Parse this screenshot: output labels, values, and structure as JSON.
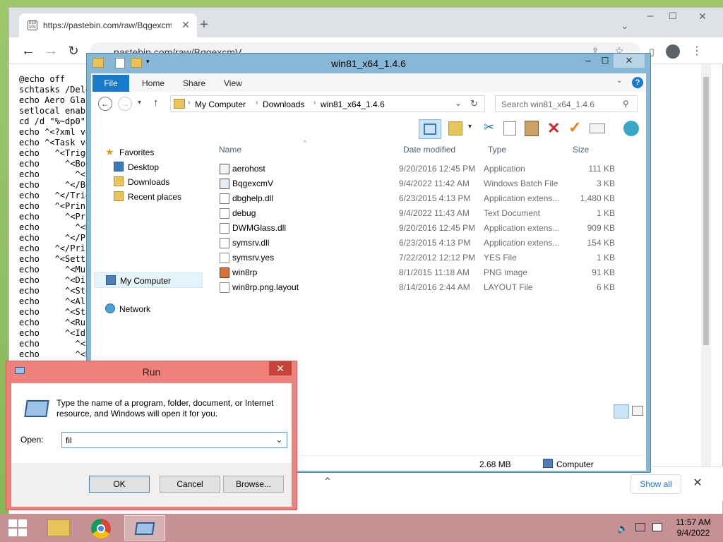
{
  "browser": {
    "tab_title": "https://pastebin.com/raw/BqgexcmV",
    "new_tab_glyph": "+",
    "url": "pastebin.com/raw/BqgexcmV",
    "code_lines": [
      "@echo off",
      "schtasks /Dele",
      "echo Aero Glas",
      "setlocal enabl",
      "cd /d \"%~dp0\"",
      "echo ^<?xml ve",
      "echo ^<Task ve",
      "echo   ^<Trigg",
      "echo     ^<Boo",
      "echo       ^<E",
      "echo     ^</Bo",
      "echo   ^</Trig",
      "echo   ^<Princ",
      "echo     ^<Pri",
      "echo       ^<R",
      "echo     ^</Pr",
      "echo   ^</Prin",
      "echo   ^<Setti",
      "echo     ^<Mul",
      "echo     ^<Dis",
      "echo     ^<Sto",
      "echo     ^<All",
      "echo     ^<Sta",
      "echo     ^<Run",
      "echo     ^<Idl",
      "echo       ^<S",
      "echo       ^<R"
    ],
    "download_bar": {
      "show_all": "Show all"
    }
  },
  "explorer": {
    "title": "win81_x64_1.4.6",
    "ribbon_tabs": [
      "File",
      "Home",
      "Share",
      "View"
    ],
    "breadcrumb": [
      "My Computer",
      "Downloads",
      "win81_x64_1.4.6"
    ],
    "search_placeholder": "Search win81_x64_1.4.6",
    "nav": {
      "favorites": "Favorites",
      "desktop": "Desktop",
      "downloads": "Downloads",
      "recent": "Recent places",
      "computer": "My Computer",
      "network": "Network"
    },
    "columns": {
      "name": "Name",
      "date": "Date modified",
      "type": "Type",
      "size": "Size"
    },
    "files": [
      {
        "name": "aerohost",
        "date": "9/20/2016 12:45 PM",
        "type": "Application",
        "size": "111 KB",
        "icon": "app-icon"
      },
      {
        "name": "BqgexcmV",
        "date": "9/4/2022 11:42 AM",
        "type": "Windows Batch File",
        "size": "3 KB",
        "icon": "batch-icon"
      },
      {
        "name": "dbghelp.dll",
        "date": "6/23/2015 4:13 PM",
        "type": "Application extens...",
        "size": "1,480 KB",
        "icon": "dll-icon"
      },
      {
        "name": "debug",
        "date": "9/4/2022 11:43 AM",
        "type": "Text Document",
        "size": "1 KB",
        "icon": "text-icon"
      },
      {
        "name": "DWMGlass.dll",
        "date": "9/20/2016 12:45 PM",
        "type": "Application extens...",
        "size": "909 KB",
        "icon": "dll-icon"
      },
      {
        "name": "symsrv.dll",
        "date": "6/23/2015 4:13 PM",
        "type": "Application extens...",
        "size": "154 KB",
        "icon": "dll-icon"
      },
      {
        "name": "symsrv.yes",
        "date": "7/22/2012 12:12 PM",
        "type": "YES File",
        "size": "1 KB",
        "icon": "file-icon"
      },
      {
        "name": "win8rp",
        "date": "8/1/2015 11:18 AM",
        "type": "PNG image",
        "size": "91 KB",
        "icon": "image-icon"
      },
      {
        "name": "win8rp.png.layout",
        "date": "8/14/2016 2:44 AM",
        "type": "LAYOUT File",
        "size": "6 KB",
        "icon": "file-icon"
      }
    ],
    "status": {
      "size": "2.68 MB",
      "location": "Computer"
    }
  },
  "run": {
    "title": "Run",
    "description": "Type the name of a program, folder, document, or Internet resource, and Windows will open it for you.",
    "open_label": "Open:",
    "open_value": "fil",
    "ok": "OK",
    "cancel": "Cancel",
    "browse": "Browse..."
  },
  "taskbar": {
    "time": "11:57 AM",
    "date": "9/4/2022"
  },
  "colors": {
    "run_frame": "#f0817a",
    "explorer_frame": "#86b7d6",
    "taskbar": "#c69194",
    "file_tab": "#1979ca"
  }
}
